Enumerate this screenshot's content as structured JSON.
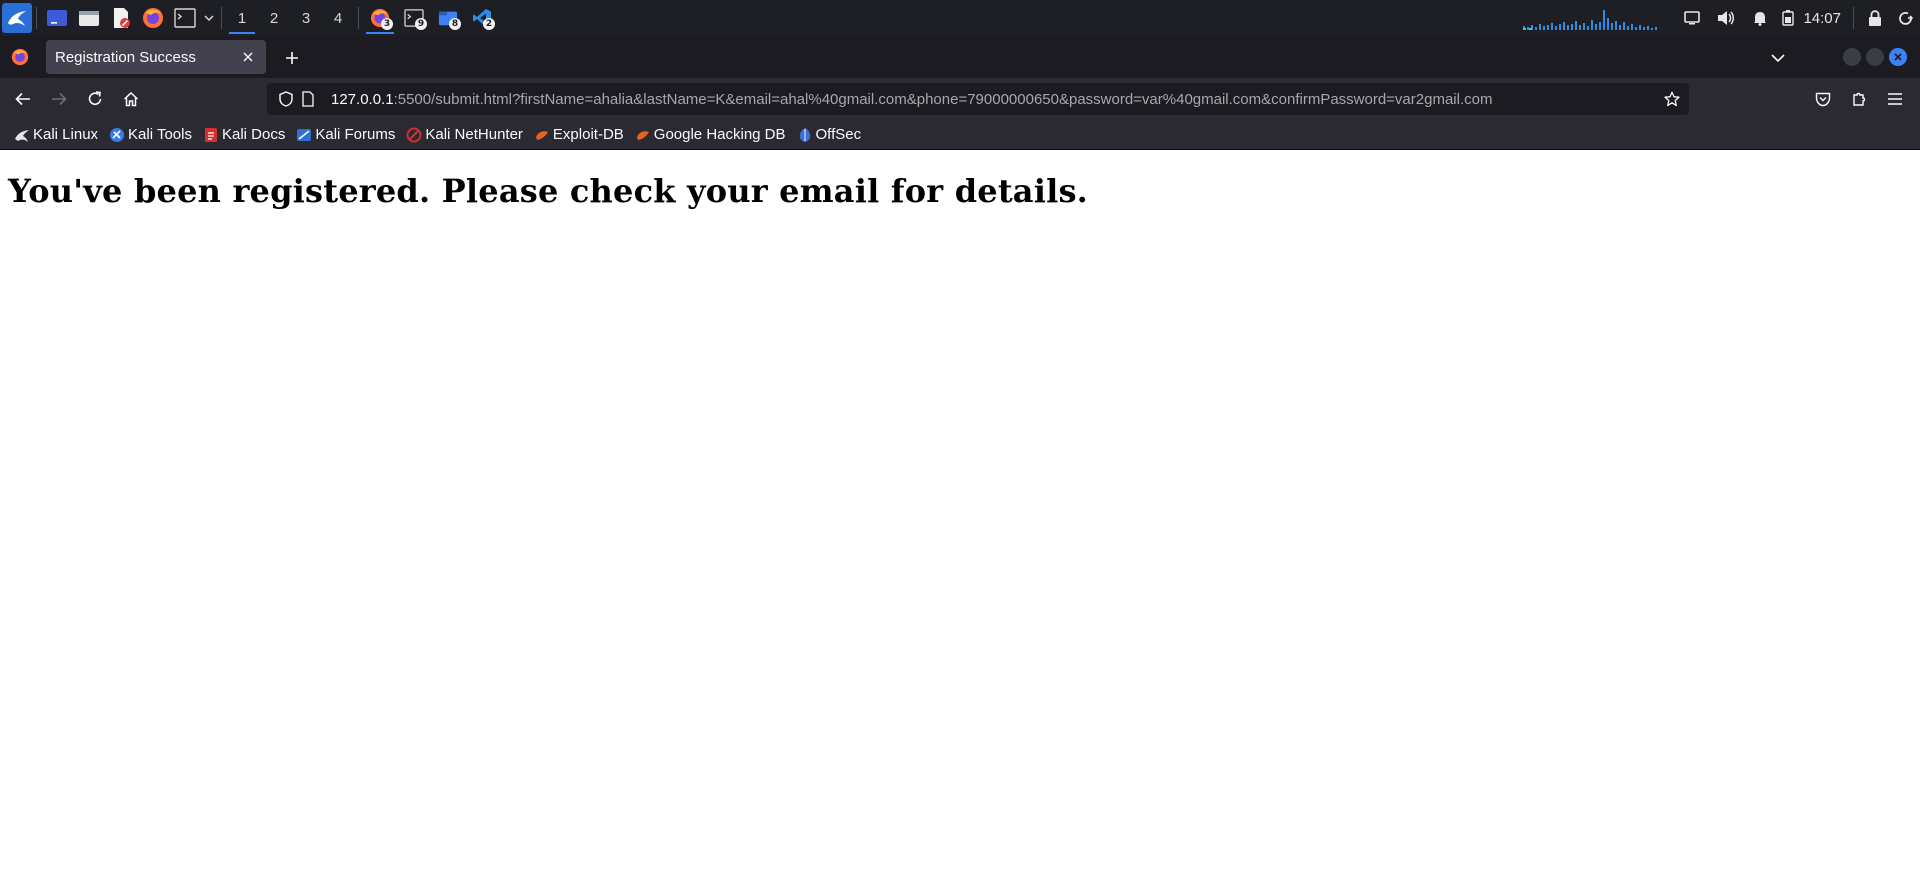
{
  "panel": {
    "workspaces": [
      "1",
      "2",
      "3",
      "4"
    ],
    "active_workspace": "1",
    "tasks": [
      {
        "name": "firefox-task",
        "badge": "3"
      },
      {
        "name": "terminal-task",
        "badge": "9"
      },
      {
        "name": "files-task",
        "badge": "8"
      },
      {
        "name": "vscode-task",
        "badge": "2"
      }
    ],
    "clock": "14:07"
  },
  "browser": {
    "tab": {
      "title": "Registration Success"
    },
    "url": {
      "host": "127.0.0.1",
      "rest": ":5500/submit.html?firstName=ahalia&lastName=K&email=ahal%40gmail.com&phone=79000000650&password=var%40gmail.com&confirmPassword=var2gmail.com"
    },
    "bookmarks": [
      {
        "label": "Kali Linux",
        "icon": "kali-dragon-icon",
        "color": "#1d1d1d"
      },
      {
        "label": "Kali Tools",
        "icon": "kali-tools-icon",
        "color": "#3c7ae6"
      },
      {
        "label": "Kali Docs",
        "icon": "kali-docs-icon",
        "color": "#d32f2f"
      },
      {
        "label": "Kali Forums",
        "icon": "kali-forums-icon",
        "color": "#2f6fd8"
      },
      {
        "label": "Kali NetHunter",
        "icon": "nethunter-icon",
        "color": "#d32f2f"
      },
      {
        "label": "Exploit-DB",
        "icon": "exploit-db-icon",
        "color": "#e8641b"
      },
      {
        "label": "Google Hacking DB",
        "icon": "ghdb-icon",
        "color": "#e8641b"
      },
      {
        "label": "OffSec",
        "icon": "offsec-icon",
        "color": "#3a6fd8"
      }
    ]
  },
  "page": {
    "heading": "You've been registered. Please check your email for details."
  },
  "colors": {
    "panel_bg": "#1d1f24",
    "accent": "#3c82f6",
    "tabstrip_bg": "#1c1b22",
    "toolbar_bg": "#2b2a33",
    "selected_tab_bg": "#42414d"
  }
}
